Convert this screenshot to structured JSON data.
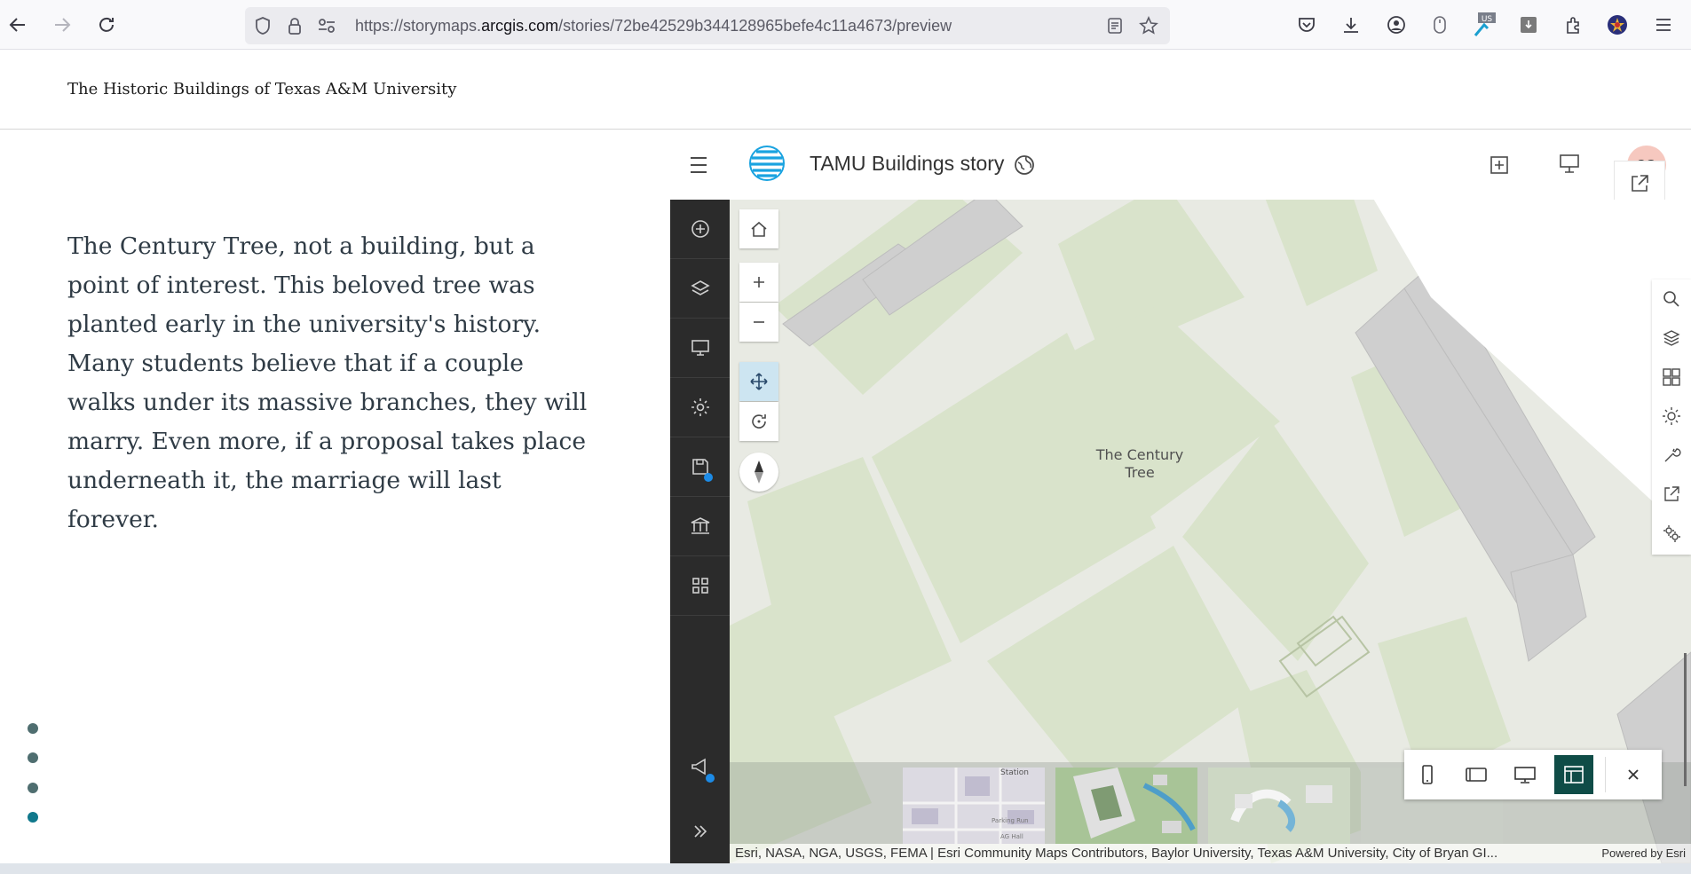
{
  "browser": {
    "url_prefix": "https://storymaps.",
    "url_domain": "arcgis.com",
    "url_suffix": "/stories/72be42529b344128965befe4c11a4673/preview",
    "extension_badge": "US"
  },
  "story": {
    "title": "The Historic Buildings of Texas A&M University",
    "narrative": "The Century Tree, not a building, but a point of interest. This beloved tree was planted early in the university's history. Many students believe that if a couple walks under its massive branches, they will marry. Even more, if a proposal takes place underneath it, the marriage will last forever.",
    "progress_total": 4,
    "progress_active": 4
  },
  "app": {
    "title": "TAMU Buildings story",
    "avatar_initials": "CG",
    "map_label_line1": "The Century",
    "map_label_line2": "Tree",
    "attribution": "Esri, NASA, NGA, USGS, FEMA | Esri Community Maps Contributors, Baylor University, Texas A&M University, City of Bryan GI...",
    "powered_by": "Powered by Esri",
    "thumb_labels": [
      "Station",
      "Parking Run",
      "AG Hall"
    ]
  },
  "colors": {
    "rail_bg": "#2b2b2b",
    "accent_teal": "#0f4c47",
    "dot_active": "#10788c",
    "notification": "#1c8be6"
  }
}
